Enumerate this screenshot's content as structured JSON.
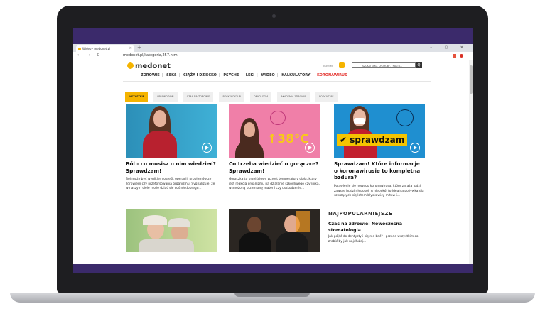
{
  "browser": {
    "tab_title": "Wideo - medonet.pl",
    "new_tab": "+",
    "window_controls": "–  ▢  ✕",
    "nav_buttons": "←  →  C",
    "url": "medonet.pl/kategoria,257.html",
    "menu": "⋮"
  },
  "site": {
    "logo": "medonet",
    "partner_label": "PARTNER",
    "search_placeholder": "SZUKAJ LEKU, CHOROBY, TRASTU...",
    "search_button": "Q",
    "nav": [
      "ZDROWIE",
      "SEKS",
      "CIĄŻA I DZIECKO",
      "PSYCHE",
      "LEKI",
      "WIDEO",
      "KALKULATORY",
      "KORONAWIRUS"
    ],
    "nav_separator": "|",
    "chips": [
      "WSZYSTKIE",
      "SPRAWDZAM!",
      "CZAS NA ZDROWIE",
      "BOSKLY DYŻUR",
      "ONKOLOGIA",
      "AKADEMIA ZDROWIA",
      "PODCASTAE"
    ]
  },
  "cards": [
    {
      "title": "Ból - co musisz o nim wiedzieć? Sprawdzam!",
      "excerpt": "Ból może być wynikiem określ, operacji, problemów ze zdrowiem czy przeforsowania organizmu. Sygnalizuje, że w naszym ciele może dziać się coś niedobrego..."
    },
    {
      "title": "Co trzeba wiedzieć o gorączce? Sprawdzam!",
      "overlay_text": "↑38°C",
      "excerpt": "Gorączka to przejściowy wzrost temperatury ciała, który jest reakcją organizmu na działanie szkodliwego czynnika, wzmożoną przemianę materii czy uszkodzenie..."
    },
    {
      "title": "Sprawdzam! Które informacje o koronawirusie to kompletna bzdura?",
      "overlay_text": "sprawdzam",
      "excerpt": "Pojawienie się nowego koronawirusa, który zaraża ludzi, zawsze budzi niepokój. A niepokój to idealna pożywka dla szerzących się lotem błyskawicy mitów i..."
    }
  ],
  "popular": {
    "heading": "NAJPOPULARNIEJSZE",
    "title": "Czas na zdrowie: Nowoczesna stomatologia",
    "excerpt": "Jak pójść do dentysty i się nie bać? I przede wszystkim co zrobić by jak najdłużej..."
  },
  "colors": {
    "accent": "#f5b400",
    "highlight_red": "#e53935",
    "screen_purple": "#3b2a6b"
  }
}
